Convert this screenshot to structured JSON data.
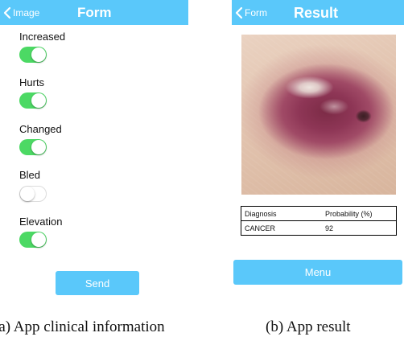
{
  "form_screen": {
    "back_label": "Image",
    "title": "Form",
    "fields": [
      {
        "label": "Increased",
        "on": true
      },
      {
        "label": "Hurts",
        "on": true
      },
      {
        "label": "Changed",
        "on": true
      },
      {
        "label": "Bled",
        "on": false
      },
      {
        "label": "Elevation",
        "on": true
      }
    ],
    "send_label": "Send"
  },
  "result_screen": {
    "back_label": "Form",
    "title": "Result",
    "image_name": "skin-lesion-photo",
    "table": {
      "headers": [
        "Diagnosis",
        "Probability (%)"
      ],
      "rows": [
        [
          "CANCER",
          "92"
        ]
      ]
    },
    "menu_label": "Menu"
  },
  "captions": {
    "left": "(a) App clinical information",
    "right": "(b) App result"
  },
  "colors": {
    "nav_bar": "#5ac8fa",
    "toggle_on": "#4cd964",
    "button": "#5ac8fa"
  }
}
